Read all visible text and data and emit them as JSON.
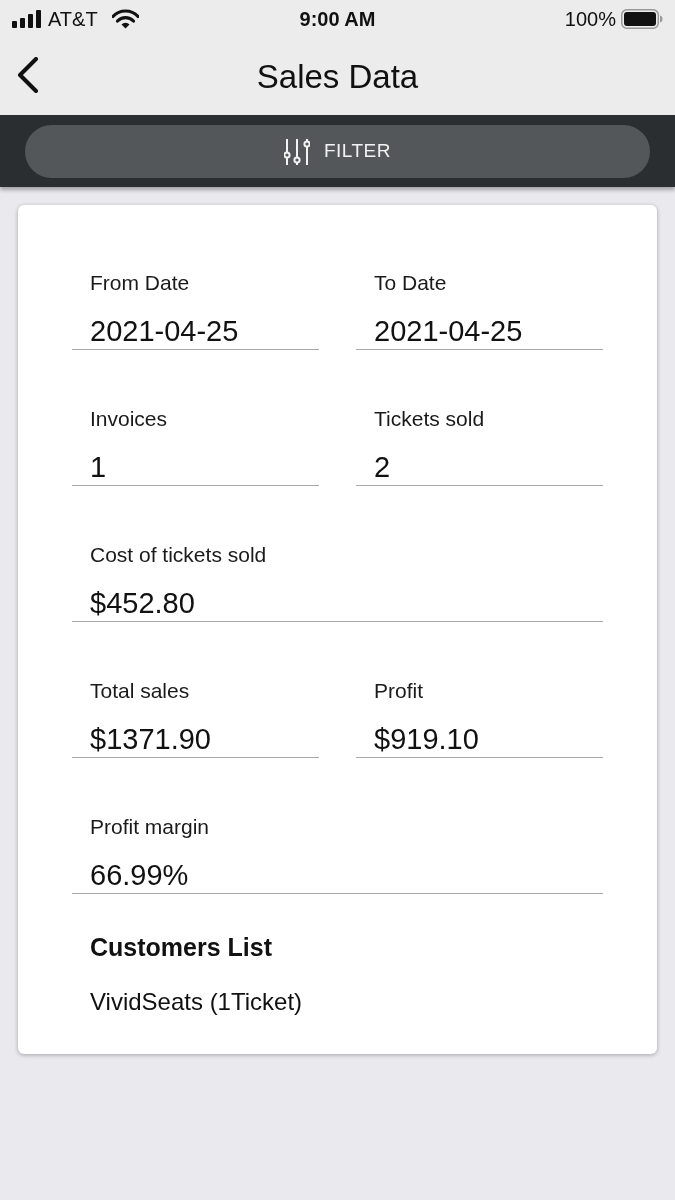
{
  "status_bar": {
    "carrier": "AT&T",
    "time": "9:00 AM",
    "battery": "100%"
  },
  "nav_bar": {
    "title": "Sales Data"
  },
  "filter_button": {
    "label": "FILTER"
  },
  "form_rows": [
    {
      "fields": [
        {
          "label": "From Date",
          "value": "2021-04-25"
        },
        {
          "label": "To Date",
          "value": "2021-04-25"
        }
      ]
    },
    {
      "fields": [
        {
          "label": "Invoices",
          "value": "1"
        },
        {
          "label": "Tickets sold",
          "value": "2"
        }
      ]
    },
    {
      "fields": [
        {
          "label": "Cost of tickets sold",
          "value": "$452.80"
        }
      ]
    },
    {
      "fields": [
        {
          "label": "Total sales",
          "value": "$1371.90"
        },
        {
          "label": "Profit",
          "value": "$919.10"
        }
      ]
    },
    {
      "fields": [
        {
          "label": "Profit margin",
          "value": "66.99%"
        }
      ]
    }
  ],
  "customers_list": {
    "title": "Customers List",
    "items": [
      "VividSeats (1Ticket)"
    ]
  }
}
